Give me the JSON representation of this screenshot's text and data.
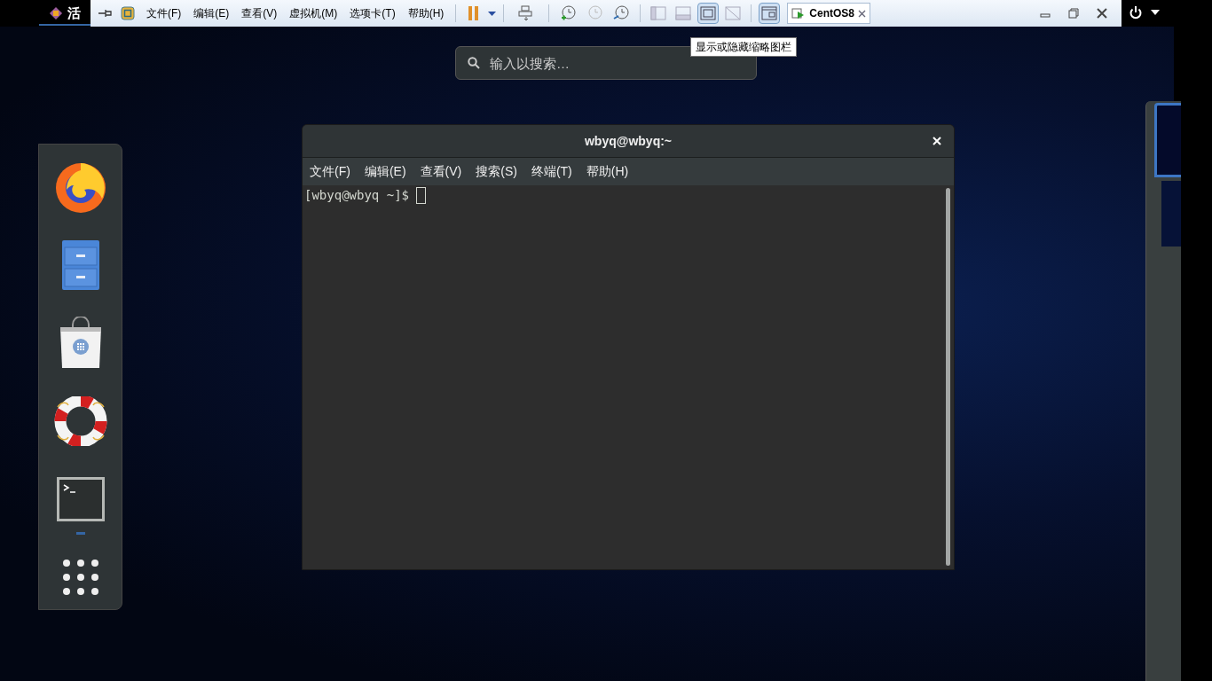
{
  "top_bar": {
    "activities": "活"
  },
  "vm_toolbar": {
    "menus": [
      "文件(F)",
      "编辑(E)",
      "查看(V)",
      "虚拟机(M)",
      "选项卡(T)",
      "帮助(H)"
    ],
    "view_buttons": [
      {
        "selected": false
      },
      {
        "selected": false
      },
      {
        "selected": true
      },
      {
        "selected": false
      }
    ],
    "library_toggle": {
      "selected": true
    },
    "tab": {
      "label": "CentOS8",
      "selected": true
    },
    "tooltip": "显示或隐藏缩略图栏"
  },
  "search": {
    "placeholder": "输入以搜索…"
  },
  "dock": {
    "items": [
      {
        "kind": "firefox",
        "running": false
      },
      {
        "kind": "files",
        "running": false
      },
      {
        "kind": "software",
        "running": false
      },
      {
        "kind": "help",
        "running": false
      },
      {
        "kind": "terminal",
        "running": true
      },
      {
        "kind": "apps",
        "running": false
      }
    ]
  },
  "terminal": {
    "title": "wbyq@wbyq:~",
    "menus": [
      "文件(F)",
      "编辑(E)",
      "查看(V)",
      "搜索(S)",
      "终端(T)",
      "帮助(H)"
    ],
    "prompt": "[wbyq@wbyq ~]$"
  },
  "workspaces": [
    {
      "selected": true
    },
    {
      "selected": false
    }
  ]
}
